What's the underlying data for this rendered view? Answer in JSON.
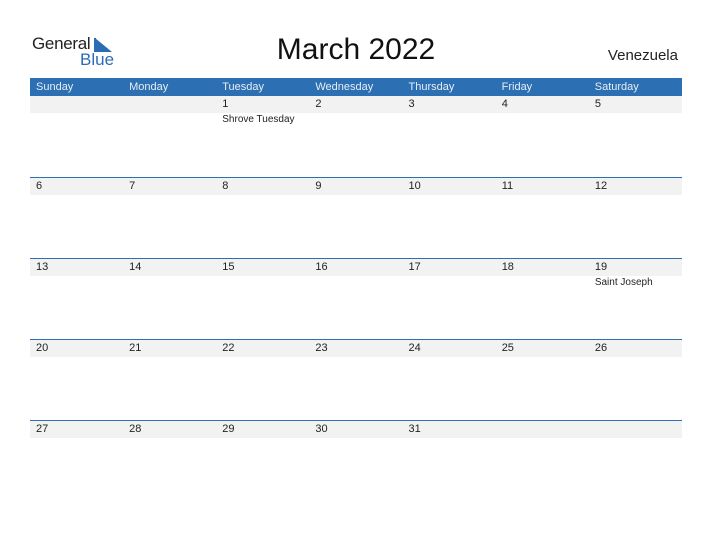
{
  "logo": {
    "general": "General",
    "blue": "Blue"
  },
  "header": {
    "title": "March 2022",
    "country": "Venezuela"
  },
  "colors": {
    "accent": "#2c6fb2",
    "date_strip": "#f2f2f2"
  },
  "weekdays": [
    "Sunday",
    "Monday",
    "Tuesday",
    "Wednesday",
    "Thursday",
    "Friday",
    "Saturday"
  ],
  "weeks": [
    [
      {
        "d": ""
      },
      {
        "d": ""
      },
      {
        "d": "1",
        "h": "Shrove Tuesday"
      },
      {
        "d": "2"
      },
      {
        "d": "3"
      },
      {
        "d": "4"
      },
      {
        "d": "5"
      }
    ],
    [
      {
        "d": "6"
      },
      {
        "d": "7"
      },
      {
        "d": "8"
      },
      {
        "d": "9"
      },
      {
        "d": "10"
      },
      {
        "d": "11"
      },
      {
        "d": "12"
      }
    ],
    [
      {
        "d": "13"
      },
      {
        "d": "14"
      },
      {
        "d": "15"
      },
      {
        "d": "16"
      },
      {
        "d": "17"
      },
      {
        "d": "18"
      },
      {
        "d": "19",
        "h": "Saint Joseph"
      }
    ],
    [
      {
        "d": "20"
      },
      {
        "d": "21"
      },
      {
        "d": "22"
      },
      {
        "d": "23"
      },
      {
        "d": "24"
      },
      {
        "d": "25"
      },
      {
        "d": "26"
      }
    ],
    [
      {
        "d": "27"
      },
      {
        "d": "28"
      },
      {
        "d": "29"
      },
      {
        "d": "30"
      },
      {
        "d": "31"
      },
      {
        "d": ""
      },
      {
        "d": ""
      }
    ]
  ]
}
